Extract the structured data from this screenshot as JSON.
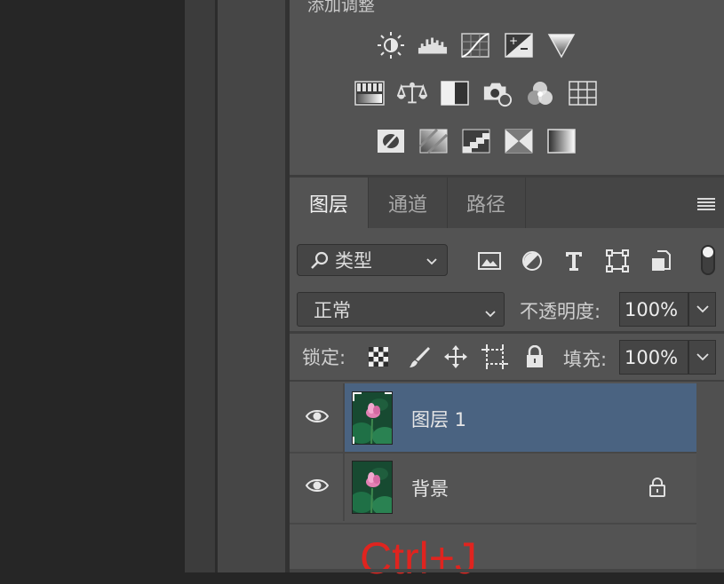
{
  "adjustments": {
    "title": "添加调整",
    "row1": [
      "brightness-contrast-icon",
      "levels-icon",
      "curves-icon",
      "exposure-icon",
      "gradient-map-triangle-icon"
    ],
    "row2": [
      "vibrance-icon",
      "color-balance-icon",
      "black-white-icon",
      "photo-filter-icon",
      "channel-mixer-icon",
      "color-lookup-icon"
    ],
    "row3": [
      "invert-icon",
      "posterize-icon",
      "threshold-icon",
      "selective-color-icon",
      "gradient-map-icon"
    ]
  },
  "tabs": {
    "layers": "图层",
    "channels": "通道",
    "paths": "路径"
  },
  "filter": {
    "kind_label": "类型"
  },
  "blend": {
    "mode": "正常",
    "opacity_label": "不透明度:",
    "opacity_value": "100%"
  },
  "lock": {
    "label": "锁定:",
    "fill_label": "填充:",
    "fill_value": "100%"
  },
  "layers": [
    {
      "name": "图层 1",
      "selected": true,
      "locked": false
    },
    {
      "name": "背景",
      "selected": false,
      "locked": true
    }
  ],
  "annotation": {
    "text": "Ctrl+J",
    "color": "#e0241f"
  },
  "colors": {
    "panel": "#535353",
    "selection": "#4a6381",
    "tabbar": "#454545"
  }
}
